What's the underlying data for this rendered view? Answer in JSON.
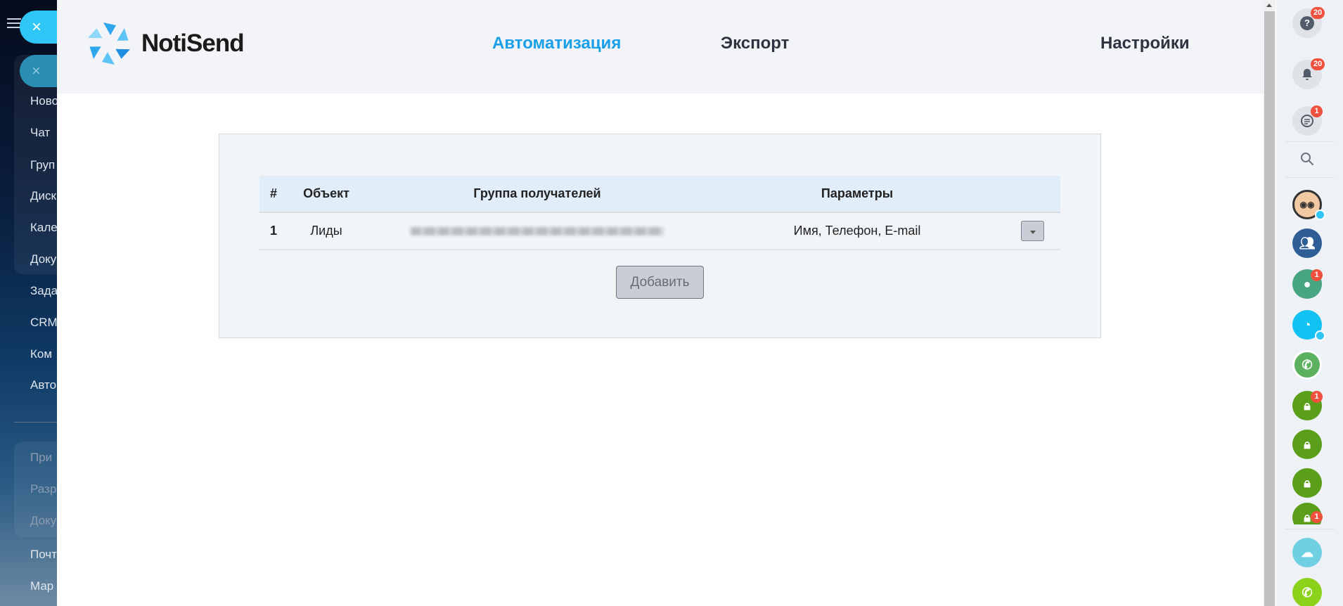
{
  "left_sidebar": {
    "close_glyph": "×",
    "items": [
      {
        "label": "Ново"
      },
      {
        "label": "Чат"
      },
      {
        "label": "Груп"
      },
      {
        "label": "Диск"
      },
      {
        "label": "Кале"
      },
      {
        "label": "Доку"
      },
      {
        "label": "Зада"
      },
      {
        "label": "CRM"
      },
      {
        "label": "Ком"
      },
      {
        "label": "Авто"
      },
      {
        "label": "При"
      },
      {
        "label": "Разр"
      },
      {
        "label": "Доку"
      },
      {
        "label": "Почт"
      },
      {
        "label": "Мар"
      }
    ]
  },
  "header": {
    "logo_text": "NotiSend",
    "nav": [
      {
        "label": "Автоматизация",
        "active": true
      },
      {
        "label": "Экспорт"
      },
      {
        "label": "Настройки"
      }
    ]
  },
  "table": {
    "headers": [
      "#",
      "Объект",
      "Группа получателей",
      "Параметры"
    ],
    "rows": [
      {
        "num": "1",
        "object": "Лиды",
        "params": "Имя, Телефон, E-mail"
      }
    ]
  },
  "add_button": "Добавить",
  "right_panel": {
    "badges": {
      "help": "20",
      "notifications": "20",
      "chats": "1",
      "contact": "1",
      "lock1": "1",
      "lock4": "1"
    }
  },
  "colors": {
    "accent": "#1a9fe8",
    "badge": "#f0513f",
    "lock_green": "#5a9e1a"
  }
}
